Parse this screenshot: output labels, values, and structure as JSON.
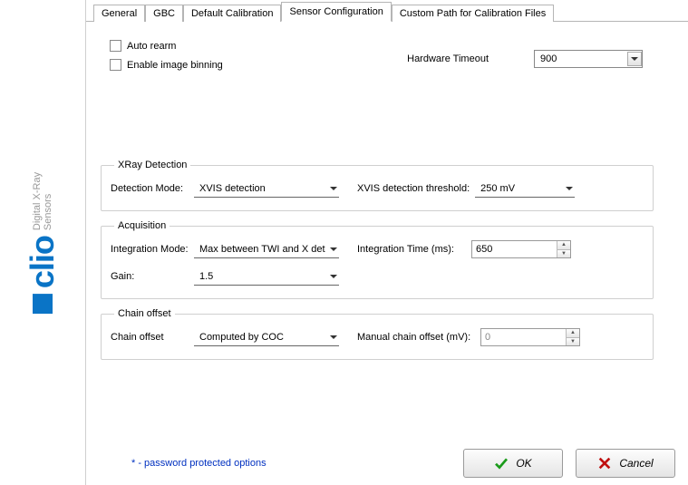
{
  "brand": {
    "name": "clio",
    "subtitle1": "Digital X-Ray",
    "subtitle2": "Sensors"
  },
  "tabs": [
    {
      "label": "General"
    },
    {
      "label": "GBC"
    },
    {
      "label": "Default Calibration"
    },
    {
      "label": "Sensor Configuration",
      "active": true
    },
    {
      "label": "Custom Path for Calibration Files"
    }
  ],
  "top": {
    "auto_rearm_label": "Auto rearm",
    "enable_binning_label": "Enable image binning",
    "hw_timeout_label": "Hardware Timeout",
    "hw_timeout_value": "900"
  },
  "xray": {
    "legend": "XRay Detection",
    "detection_mode_label": "Detection Mode:",
    "detection_mode_value": "XVIS detection",
    "threshold_label": "XVIS detection threshold:",
    "threshold_value": "250 mV"
  },
  "acq": {
    "legend": "Acquisition",
    "integration_mode_label": "Integration Mode:",
    "integration_mode_value": "Max between TWI and X det",
    "integration_time_label": "Integration Time (ms):",
    "integration_time_value": "650",
    "gain_label": "Gain:",
    "gain_value": "1.5"
  },
  "chain": {
    "legend": "Chain  offset",
    "chain_offset_label": "Chain offset",
    "chain_offset_value": "Computed by COC",
    "manual_offset_label": "Manual chain offset (mV):",
    "manual_offset_value": "0"
  },
  "footer": {
    "note": "* - password protected options",
    "ok": "OK",
    "cancel": "Cancel"
  }
}
